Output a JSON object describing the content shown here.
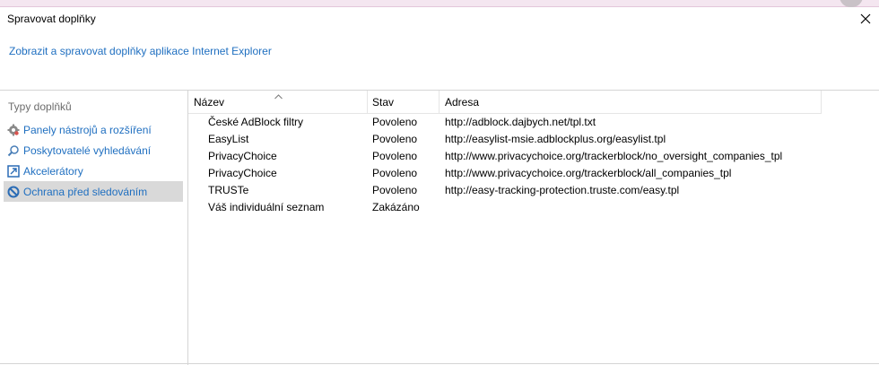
{
  "window": {
    "title": "Spravovat doplňky",
    "subtitle": "Zobrazit a spravovat doplňky aplikace Internet Explorer"
  },
  "sidebar": {
    "heading": "Typy doplňků",
    "items": [
      {
        "label": "Panely nástrojů a rozšíření",
        "icon": "gear-icon",
        "selected": false
      },
      {
        "label": "Poskytovatelé vyhledávání",
        "icon": "magnifier-icon",
        "selected": false
      },
      {
        "label": "Akcelerátory",
        "icon": "accelerator-icon",
        "selected": false
      },
      {
        "label": "Ochrana před sledováním",
        "icon": "no-tracking-icon",
        "selected": true
      }
    ]
  },
  "table": {
    "columns": [
      "Název",
      "Stav",
      "Adresa"
    ],
    "rows": [
      {
        "name": "České AdBlock filtry",
        "status": "Povoleno",
        "address": "http://adblock.dajbych.net/tpl.txt"
      },
      {
        "name": "EasyList",
        "status": "Povoleno",
        "address": "http://easylist-msie.adblockplus.org/easylist.tpl"
      },
      {
        "name": "PrivacyChoice",
        "status": "Povoleno",
        "address": "http://www.privacychoice.org/trackerblock/no_oversight_companies_tpl"
      },
      {
        "name": "PrivacyChoice",
        "status": "Povoleno",
        "address": "http://www.privacychoice.org/trackerblock/all_companies_tpl"
      },
      {
        "name": "TRUSTe",
        "status": "Povoleno",
        "address": "http://easy-tracking-protection.truste.com/easy.tpl"
      },
      {
        "name": "Váš individuální seznam",
        "status": "Zakázáno",
        "address": ""
      }
    ]
  },
  "colors": {
    "link_blue": "#1f6fc0",
    "selected_bg": "#d9d9d9"
  }
}
